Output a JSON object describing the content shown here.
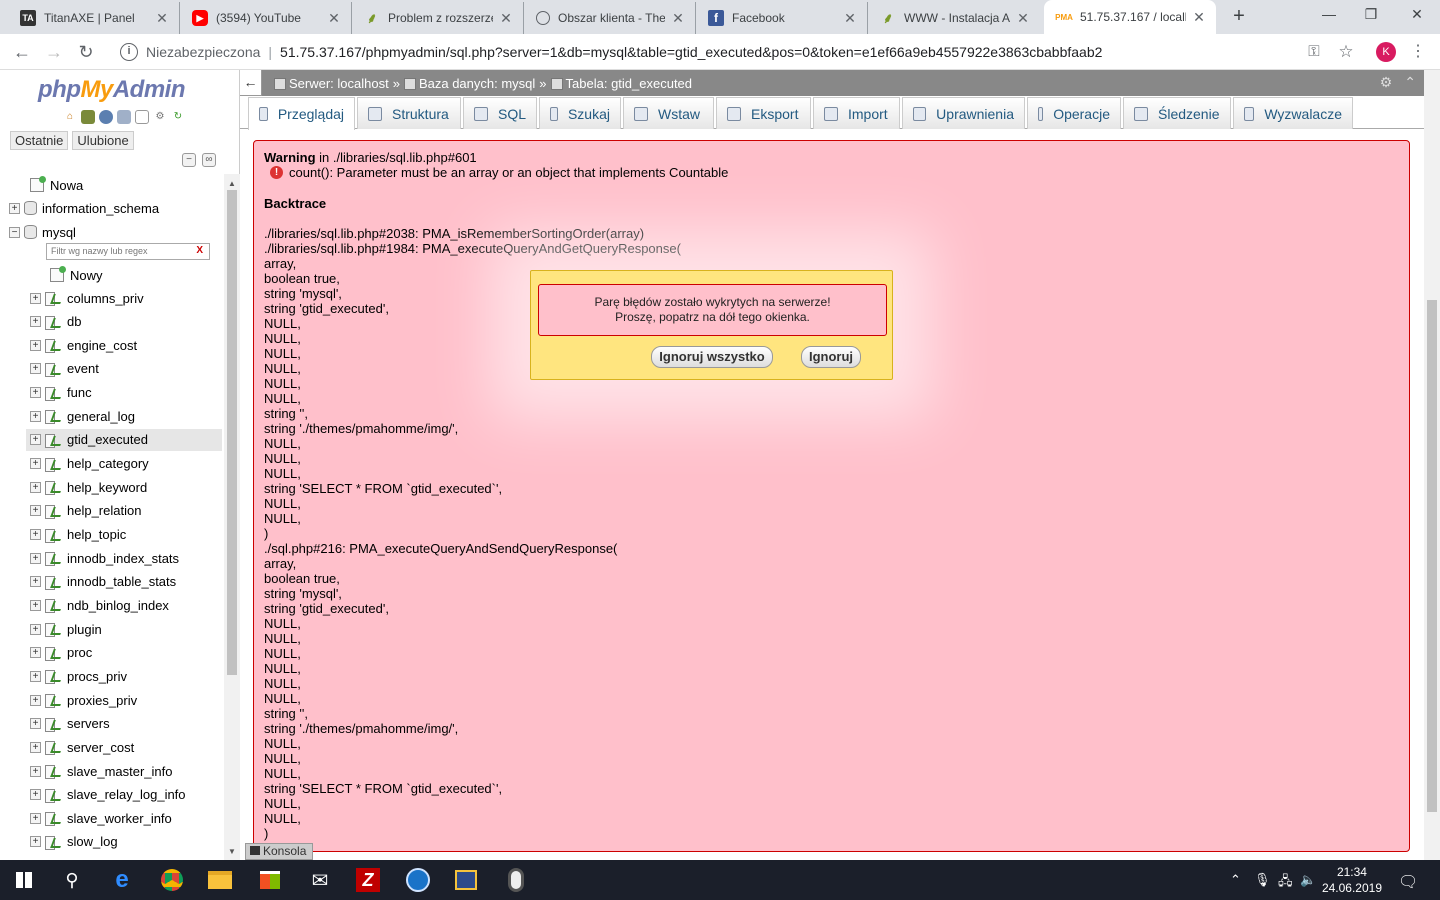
{
  "browser": {
    "tabs": [
      {
        "title": "TitanAXE | Panel",
        "icon": "titanaxe-favicon",
        "active": false
      },
      {
        "title": "(3594) YouTube",
        "icon": "youtube-favicon",
        "active": false
      },
      {
        "title": "Problem z rozszerze",
        "icon": "forum-favicon",
        "active": false
      },
      {
        "title": "Obszar klienta - The",
        "icon": "globe-favicon",
        "active": false
      },
      {
        "title": "Facebook",
        "icon": "facebook-favicon",
        "active": false
      },
      {
        "title": "WWW - Instalacja A",
        "icon": "forum-favicon",
        "active": false
      },
      {
        "title": "51.75.37.167 / locall",
        "icon": "phpmyadmin-favicon",
        "active": true
      }
    ],
    "new_tab": "+",
    "address": {
      "security": "Niezabezpieczona",
      "separator": "|",
      "url": "51.75.37.167/phpmyadmin/sql.php?server=1&db=mysql&table=gtid_executed&pos=0&token=e1ef66a9eb4557922e3863cbabbfaab2"
    },
    "profile_initial": "K"
  },
  "sidebar": {
    "logo": {
      "php": "php",
      "my": "My",
      "admin": "Admin"
    },
    "recent_tabs": [
      "Ostatnie",
      "Ulubione"
    ],
    "tree_top": [
      {
        "label": "Nowa",
        "type": "new"
      },
      {
        "label": "information_schema",
        "type": "db"
      },
      {
        "label": "mysql",
        "type": "db-open"
      }
    ],
    "filter_placeholder": "Filtr wg nazwy lub regex",
    "filter_clear": "X",
    "new_table": "Nowy",
    "tables": [
      "columns_priv",
      "db",
      "engine_cost",
      "event",
      "func",
      "general_log",
      "gtid_executed",
      "help_category",
      "help_keyword",
      "help_relation",
      "help_topic",
      "innodb_index_stats",
      "innodb_table_stats",
      "ndb_binlog_index",
      "plugin",
      "proc",
      "procs_priv",
      "proxies_priv",
      "servers",
      "server_cost",
      "slave_master_info",
      "slave_relay_log_info",
      "slave_worker_info",
      "slow_log"
    ],
    "selected_table": "gtid_executed"
  },
  "topbar": {
    "server": "Serwer: localhost",
    "database": "Baza danych: mysql",
    "table": "Tabela: gtid_executed",
    "sep": "»"
  },
  "menu_tabs": [
    "Przeglądaj",
    "Struktura",
    "SQL",
    "Szukaj",
    "Wstaw",
    "Eksport",
    "Import",
    "Uprawnienia",
    "Operacje",
    "Śledzenie",
    "Wyzwalacze"
  ],
  "error": {
    "title_bold": "Warning",
    "title_rest": " in ./libraries/sql.lib.php#601",
    "message": "count(): Parameter must be an array or an object that implements Countable",
    "backtrace_label": "Backtrace",
    "lines": [
      "./libraries/sql.lib.php#2038: PMA_isRememberSortingOrder(array)",
      "./libraries/sql.lib.php#1984: PMA_executeQueryAndGetQueryResponse(",
      "array,",
      "boolean true,",
      "string 'mysql',",
      "string 'gtid_executed',",
      "NULL,",
      "NULL,",
      "NULL,",
      "NULL,",
      "NULL,",
      "NULL,",
      "string '',",
      "string './themes/pmahomme/img/',",
      "NULL,",
      "NULL,",
      "NULL,",
      "string 'SELECT * FROM `gtid_executed`',",
      "NULL,",
      "NULL,",
      ")",
      "./sql.php#216: PMA_executeQueryAndSendQueryResponse(",
      "array,",
      "boolean true,",
      "string 'mysql',",
      "string 'gtid_executed',",
      "NULL,",
      "NULL,",
      "NULL,",
      "NULL,",
      "NULL,",
      "NULL,",
      "string '',",
      "string './themes/pmahomme/img/',",
      "NULL,",
      "NULL,",
      "NULL,",
      "string 'SELECT * FROM `gtid_executed`',",
      "NULL,",
      "NULL,",
      ")"
    ]
  },
  "modal": {
    "line1": "Parę błędów zostało wykrytych na serwerze!",
    "line2": "Proszę, popatrz na dół tego okienka.",
    "ignore_all": "Ignoruj wszystko",
    "ignore": "Ignoruj"
  },
  "console_label": "Konsola",
  "taskbar": {
    "time": "21:34",
    "date": "24.06.2019"
  },
  "colors": {
    "pma_blue": "#235a81",
    "error_bg": "#ffc0cb",
    "modal_bg": "#ffe57f",
    "taskbar_bg": "#1b1f2a"
  }
}
